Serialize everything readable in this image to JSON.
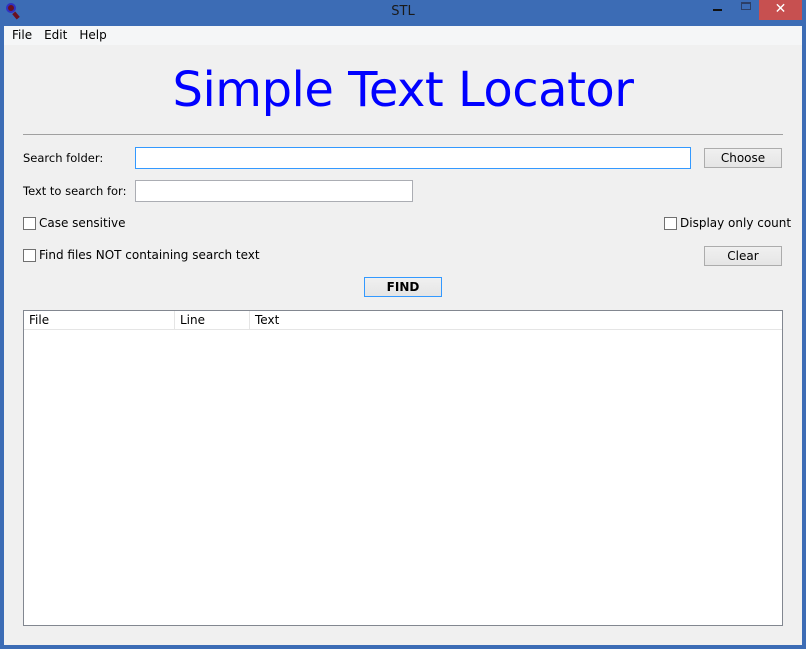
{
  "window": {
    "title": "STL",
    "close_glyph": "✕"
  },
  "menu": [
    "File",
    "Edit",
    "Help"
  ],
  "heading": "Simple Text Locator",
  "form": {
    "search_folder_label": "Search folder:",
    "search_folder_value": "",
    "text_label": "Text to search for:",
    "text_value": "",
    "choose_label": "Choose",
    "case_sensitive": {
      "label": "Case sensitive",
      "checked": false
    },
    "display_only_count": {
      "label": "Display only count",
      "checked": false
    },
    "not_containing": {
      "label": "Find files NOT containing search text",
      "checked": false
    },
    "clear_label": "Clear",
    "find_label": "FIND"
  },
  "results": {
    "columns": [
      "File",
      "Line",
      "Text"
    ],
    "rows": []
  }
}
